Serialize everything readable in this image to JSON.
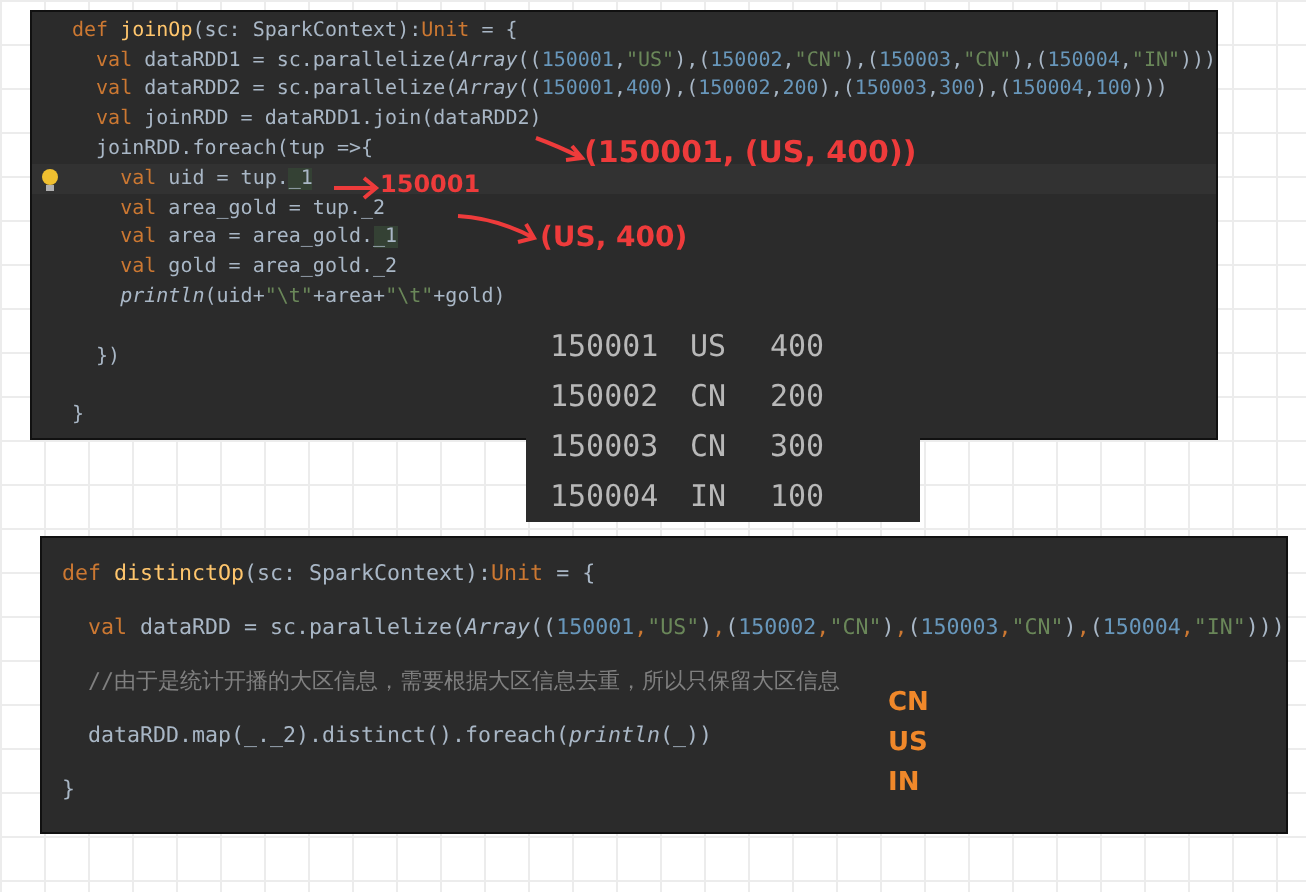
{
  "join_snippet": {
    "lines": [
      {
        "kind": "code",
        "tokens": [
          {
            "kind": "keyword",
            "text": "def "
          },
          {
            "kind": "function",
            "text": "joinOp"
          },
          {
            "kind": "plain",
            "text": "(sc: SparkContext):"
          },
          {
            "kind": "keyword",
            "text": "Unit"
          },
          {
            "kind": "plain",
            "text": " = {"
          }
        ]
      },
      {
        "kind": "code",
        "tokens": [
          {
            "kind": "keyword",
            "text": "  val "
          },
          {
            "kind": "plain",
            "text": "dataRDD1 = sc.parallelize("
          },
          {
            "kind": "italic",
            "text": "Array"
          },
          {
            "kind": "plain",
            "text": "(("
          },
          {
            "kind": "number",
            "text": "150001"
          },
          {
            "kind": "plain",
            "text": ","
          },
          {
            "kind": "string",
            "text": "\"US\""
          },
          {
            "kind": "plain",
            "text": "),("
          },
          {
            "kind": "number",
            "text": "150002"
          },
          {
            "kind": "plain",
            "text": ","
          },
          {
            "kind": "string",
            "text": "\"CN\""
          },
          {
            "kind": "plain",
            "text": "),("
          },
          {
            "kind": "number",
            "text": "150003"
          },
          {
            "kind": "plain",
            "text": ","
          },
          {
            "kind": "string",
            "text": "\"CN\""
          },
          {
            "kind": "plain",
            "text": "),("
          },
          {
            "kind": "number",
            "text": "150004"
          },
          {
            "kind": "plain",
            "text": ","
          },
          {
            "kind": "string",
            "text": "\"IN\""
          },
          {
            "kind": "plain",
            "text": ")))"
          }
        ]
      },
      {
        "kind": "code",
        "tokens": [
          {
            "kind": "keyword",
            "text": "  val "
          },
          {
            "kind": "plain",
            "text": "dataRDD2 = sc.parallelize("
          },
          {
            "kind": "italic",
            "text": "Array"
          },
          {
            "kind": "plain",
            "text": "(("
          },
          {
            "kind": "number",
            "text": "150001"
          },
          {
            "kind": "plain",
            "text": ","
          },
          {
            "kind": "number",
            "text": "400"
          },
          {
            "kind": "plain",
            "text": "),("
          },
          {
            "kind": "number",
            "text": "150002"
          },
          {
            "kind": "plain",
            "text": ","
          },
          {
            "kind": "number",
            "text": "200"
          },
          {
            "kind": "plain",
            "text": "),("
          },
          {
            "kind": "number",
            "text": "150003"
          },
          {
            "kind": "plain",
            "text": ","
          },
          {
            "kind": "number",
            "text": "300"
          },
          {
            "kind": "plain",
            "text": "),("
          },
          {
            "kind": "number",
            "text": "150004"
          },
          {
            "kind": "plain",
            "text": ","
          },
          {
            "kind": "number",
            "text": "100"
          },
          {
            "kind": "plain",
            "text": ")))"
          }
        ]
      },
      {
        "kind": "code",
        "tokens": [
          {
            "kind": "keyword",
            "text": "  val "
          },
          {
            "kind": "plain",
            "text": "joinRDD = dataRDD1.join(dataRDD2)"
          }
        ]
      },
      {
        "kind": "code",
        "tokens": [
          {
            "kind": "plain",
            "text": "  joinRDD.foreach(tup =>{"
          }
        ]
      },
      {
        "kind": "current",
        "tokens": [
          {
            "kind": "keyword",
            "text": "    val "
          },
          {
            "kind": "plain",
            "text": "uid = tup."
          },
          {
            "kind": "match",
            "text": "_1"
          }
        ]
      },
      {
        "kind": "code",
        "tokens": [
          {
            "kind": "keyword",
            "text": "    val "
          },
          {
            "kind": "plain",
            "text": "area_gold = tup._2"
          }
        ]
      },
      {
        "kind": "code",
        "tokens": [
          {
            "kind": "keyword",
            "text": "    val "
          },
          {
            "kind": "plain",
            "text": "area = area_gold."
          },
          {
            "kind": "match",
            "text": "_1"
          }
        ]
      },
      {
        "kind": "code",
        "tokens": [
          {
            "kind": "keyword",
            "text": "    val "
          },
          {
            "kind": "plain",
            "text": "gold = area_gold._2"
          }
        ]
      },
      {
        "kind": "code",
        "tokens": [
          {
            "kind": "italic",
            "text": "    println"
          },
          {
            "kind": "plain",
            "text": "(uid+"
          },
          {
            "kind": "string",
            "text": "\"\\t\""
          },
          {
            "kind": "plain",
            "text": "+area+"
          },
          {
            "kind": "string",
            "text": "\"\\t\""
          },
          {
            "kind": "plain",
            "text": "+gold)"
          }
        ]
      },
      {
        "kind": "blank"
      },
      {
        "kind": "code",
        "tokens": [
          {
            "kind": "plain",
            "text": "  })"
          }
        ]
      },
      {
        "kind": "blank"
      },
      {
        "kind": "code",
        "tokens": [
          {
            "kind": "plain",
            "text": "}"
          }
        ]
      }
    ]
  },
  "join_output": {
    "rows": [
      {
        "uid": "150001",
        "area": "US",
        "gold": "400"
      },
      {
        "uid": "150002",
        "area": "CN",
        "gold": "200"
      },
      {
        "uid": "150003",
        "area": "CN",
        "gold": "300"
      },
      {
        "uid": "150004",
        "area": "IN",
        "gold": "100"
      }
    ]
  },
  "join_notes": [
    "(150001, (US, 400))",
    "150001",
    "(US, 400)"
  ],
  "distinct_snippet": {
    "lines": [
      {
        "kind": "code",
        "tokens": [
          {
            "kind": "keyword",
            "text": "def "
          },
          {
            "kind": "function",
            "text": "distinctOp"
          },
          {
            "kind": "plain",
            "text": "(sc: SparkContext):"
          },
          {
            "kind": "keyword",
            "text": "Unit"
          },
          {
            "kind": "plain",
            "text": " = {"
          }
        ]
      },
      {
        "kind": "code",
        "tokens": [
          {
            "kind": "keyword",
            "text": "  val "
          },
          {
            "kind": "plain",
            "text": "dataRDD = sc.parallelize("
          },
          {
            "kind": "italic",
            "text": "Array"
          },
          {
            "kind": "plain",
            "text": "(("
          },
          {
            "kind": "number",
            "text": "150001"
          },
          {
            "kind": "keyword",
            "text": ","
          },
          {
            "kind": "string",
            "text": "\"US\""
          },
          {
            "kind": "plain",
            "text": ")"
          },
          {
            "kind": "keyword",
            "text": ","
          },
          {
            "kind": "plain",
            "text": "("
          },
          {
            "kind": "number",
            "text": "150002"
          },
          {
            "kind": "keyword",
            "text": ","
          },
          {
            "kind": "string",
            "text": "\"CN\""
          },
          {
            "kind": "plain",
            "text": ")"
          },
          {
            "kind": "keyword",
            "text": ","
          },
          {
            "kind": "plain",
            "text": "("
          },
          {
            "kind": "number",
            "text": "150003"
          },
          {
            "kind": "keyword",
            "text": ","
          },
          {
            "kind": "string",
            "text": "\"CN\""
          },
          {
            "kind": "plain",
            "text": ")"
          },
          {
            "kind": "keyword",
            "text": ","
          },
          {
            "kind": "plain",
            "text": "("
          },
          {
            "kind": "number",
            "text": "150004"
          },
          {
            "kind": "keyword",
            "text": ","
          },
          {
            "kind": "string",
            "text": "\"IN\""
          },
          {
            "kind": "plain",
            "text": ")))"
          }
        ]
      },
      {
        "kind": "code",
        "tokens": [
          {
            "kind": "comment",
            "text": "  //由于是统计开播的大区信息，需要根据大区信息去重，所以只保留大区信息"
          }
        ]
      },
      {
        "kind": "code",
        "tokens": [
          {
            "kind": "plain",
            "text": "  dataRDD.map(_._2).distinct().foreach("
          },
          {
            "kind": "italic",
            "text": "println"
          },
          {
            "kind": "plain",
            "text": "(_))"
          }
        ]
      },
      {
        "kind": "code",
        "tokens": [
          {
            "kind": "plain",
            "text": "}"
          }
        ]
      }
    ]
  },
  "distinct_output": [
    "CN",
    "US",
    "IN"
  ]
}
